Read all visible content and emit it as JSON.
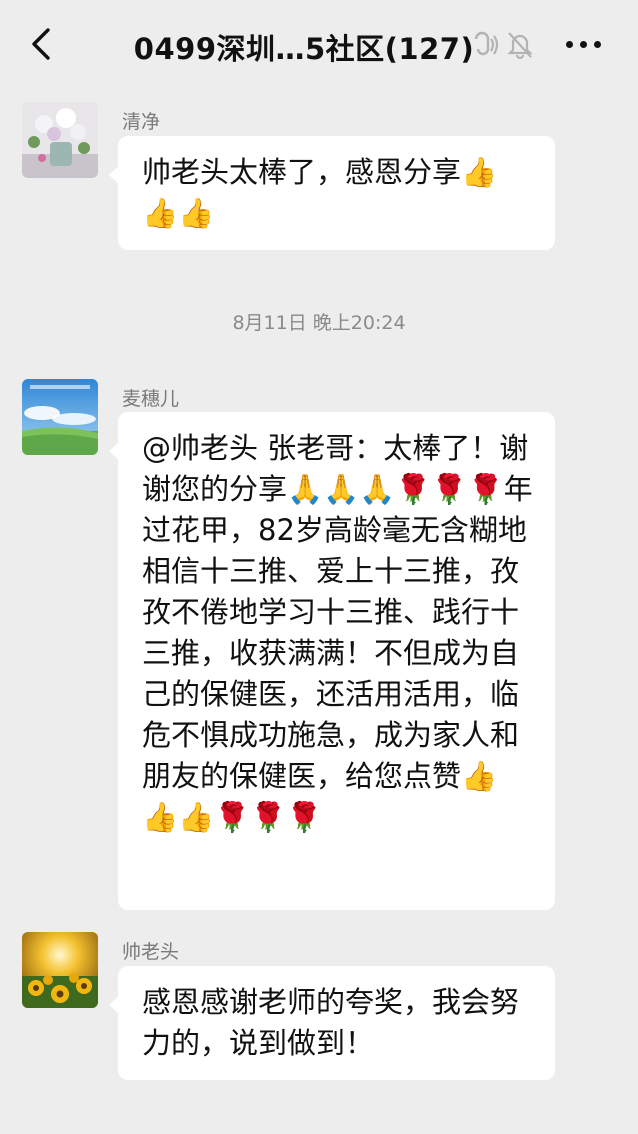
{
  "header": {
    "title": "0499深圳…5社区(127)",
    "back_icon": "chevron-left-icon",
    "earpiece_icon": "earpiece-icon",
    "mute_icon": "bell-mute-icon",
    "more_icon": "more-dots-icon"
  },
  "messages": [
    {
      "sender": "清净",
      "avatar": "flower-vase-avatar",
      "text": "帅老头太棒了，感恩分享👍👍👍"
    },
    {
      "timestamp": "8月11日 晚上20:24"
    },
    {
      "sender": "麦穗儿",
      "avatar": "sky-field-avatar",
      "text": "@帅老头  张老哥：太棒了！谢谢您的分享🙏🙏🙏🌹🌹🌹年过花甲，82岁高龄毫无含糊地相信十三推、爱上十三推，孜孜不倦地学习十三推、践行十三推，收获满满！不但成为自己的保健医，还活用活用，临危不惧成功施急，成为家人和朋友的保健医，给您点赞👍👍👍🌹🌹🌹"
    },
    {
      "sender": "帅老头",
      "avatar": "sunflower-sunset-avatar",
      "text": "感恩感谢老师的夸奖，我会努力的，说到做到！"
    }
  ]
}
